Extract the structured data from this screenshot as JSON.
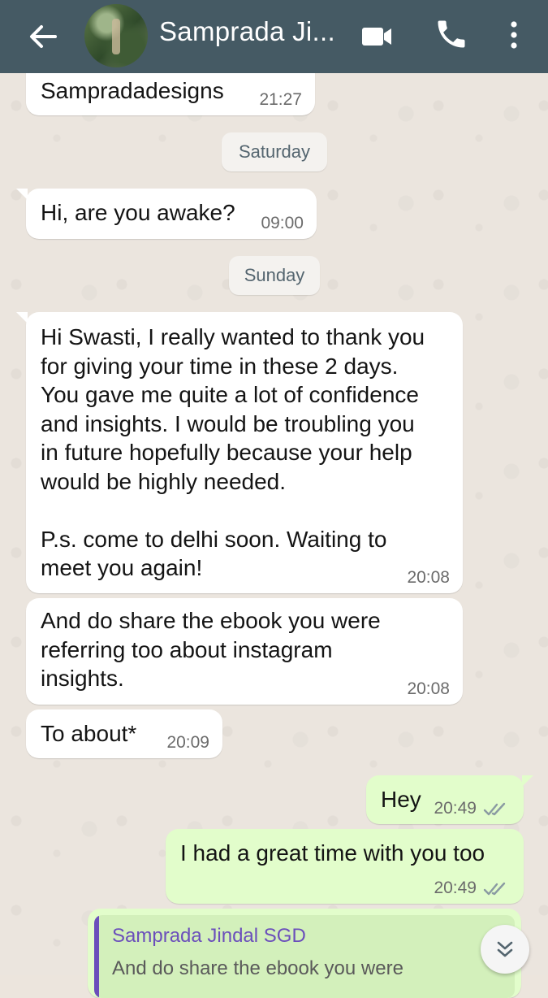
{
  "header": {
    "contact_name": "Samprada Ji...",
    "back_icon": "arrow-left-icon",
    "video_icon": "video-camera-icon",
    "call_icon": "phone-icon",
    "menu_icon": "more-vertical-icon",
    "color": "#455a64"
  },
  "messages": [
    {
      "direction": "in",
      "text": "Sampradadesigns",
      "time": "21:27"
    },
    {
      "direction": "date",
      "text": "Saturday"
    },
    {
      "direction": "in",
      "text": "Hi, are you awake?",
      "time": "09:00"
    },
    {
      "direction": "date",
      "text": "Sunday"
    },
    {
      "direction": "in",
      "text": "Hi Swasti, I really wanted to thank you\nfor giving your time in these 2 days.\nYou gave me quite a lot of confidence\nand insights. I would be troubling you\nin future hopefully because your help\nwould be highly needed.\n\nP.s. come to delhi soon. Waiting to\nmeet you again!",
      "time": "20:08"
    },
    {
      "direction": "in",
      "text": "And do share the ebook you were\nreferring too about instagram\ninsights.",
      "time": "20:08"
    },
    {
      "direction": "in",
      "text": "To about*",
      "time": "20:09"
    },
    {
      "direction": "out",
      "text": "Hey",
      "time": "20:49",
      "status": "read"
    },
    {
      "direction": "out",
      "text": "I had a great time with you too",
      "time": "20:49",
      "status": "read"
    }
  ],
  "reply_preview": {
    "author": "Samprada Jindal SGD",
    "text": "And do share the ebook you were"
  },
  "colors": {
    "outgoing_bubble": "#e2fdcb",
    "incoming_bubble": "#ffffff",
    "reply_author": "#6b4fbb",
    "read_ticks": "#8a9aa2"
  },
  "scroll_button_icon": "double-chevron-down-icon"
}
